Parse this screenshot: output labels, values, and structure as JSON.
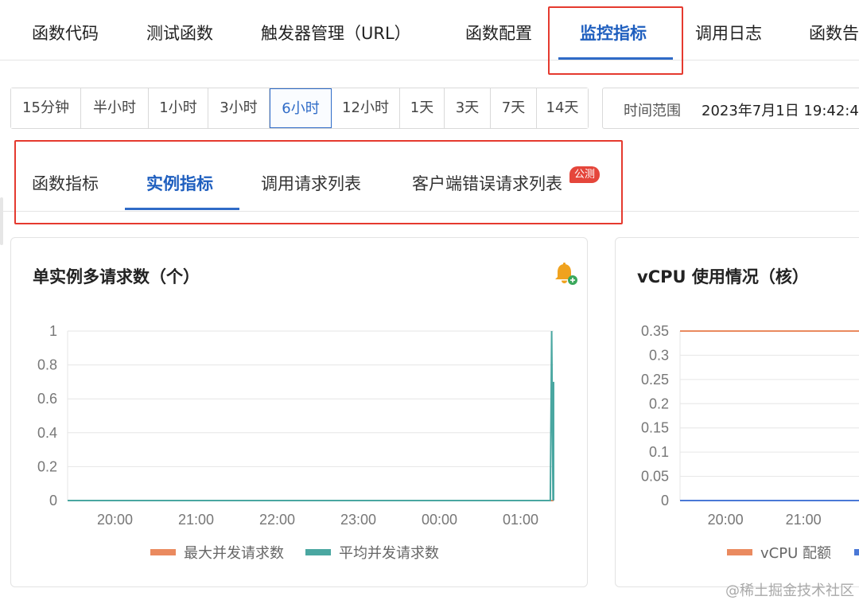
{
  "top_tabs": {
    "items": [
      {
        "label": "函数代码"
      },
      {
        "label": "测试函数"
      },
      {
        "label": "触发器管理（URL）"
      },
      {
        "label": "函数配置"
      },
      {
        "label": "监控指标"
      },
      {
        "label": "调用日志"
      },
      {
        "label": "函数告"
      }
    ],
    "active_index": 4
  },
  "time_buttons": [
    "15分钟",
    "半小时",
    "1小时",
    "3小时",
    "6小时",
    "12小时",
    "1天",
    "3天",
    "7天",
    "14天"
  ],
  "time_active": "6小时",
  "range": {
    "label": "时间范围",
    "value": "2023年7月1日 19:42:4"
  },
  "sub_tabs": {
    "items": [
      {
        "label": "函数指标"
      },
      {
        "label": "实例指标"
      },
      {
        "label": "调用请求列表"
      },
      {
        "label": "客户端错误请求列表"
      }
    ],
    "active_index": 1,
    "badge": "公测"
  },
  "cards": [
    {
      "title": "单实例多请求数（个）",
      "icon": "bell-add-icon"
    },
    {
      "title": "vCPU 使用情况（核）"
    }
  ],
  "colors": {
    "accent": "#2f6bc7",
    "series_orange": "#ea8a5f",
    "series_teal": "#4aa7a1",
    "series_blue": "#4a78d6",
    "highlight": "#e53a2f"
  },
  "chart_data": [
    {
      "type": "line",
      "title": "单实例多请求数（个）",
      "x_ticks": [
        "20:00",
        "21:00",
        "22:00",
        "23:00",
        "00:00",
        "01:00"
      ],
      "y_ticks": [
        "1",
        "0.8",
        "0.6",
        "0.4",
        "0.2",
        "0"
      ],
      "ylim": [
        0,
        1
      ],
      "x": [
        "19:25",
        "01:20",
        "01:22",
        "01:23",
        "01:24",
        "01:25",
        "01:30"
      ],
      "series": [
        {
          "name": "最大并发请求数",
          "color": "#ea8a5f",
          "values": [
            0,
            0,
            0,
            0,
            0,
            0,
            0
          ]
        },
        {
          "name": "平均并发请求数",
          "color": "#4aa7a1",
          "values": [
            0,
            0,
            0,
            1,
            0,
            0.7,
            0
          ]
        }
      ],
      "grid": true,
      "legend": "bottom"
    },
    {
      "type": "line",
      "title": "vCPU 使用情况（核）",
      "x_ticks": [
        "20:00",
        "21:00"
      ],
      "y_ticks": [
        "0.35",
        "0.3",
        "0.25",
        "0.2",
        "0.15",
        "0.1",
        "0.05",
        "0"
      ],
      "ylim": [
        0,
        0.35
      ],
      "x": [
        "19:25",
        "21:45"
      ],
      "series": [
        {
          "name": "vCPU 配额",
          "color": "#ea8a5f",
          "values": [
            0.35,
            0.35
          ]
        },
        {
          "name": "",
          "color": "#4a78d6",
          "values": [
            0,
            0
          ]
        }
      ],
      "grid": true,
      "legend": "bottom"
    }
  ],
  "watermark": "@稀土掘金技术社区"
}
